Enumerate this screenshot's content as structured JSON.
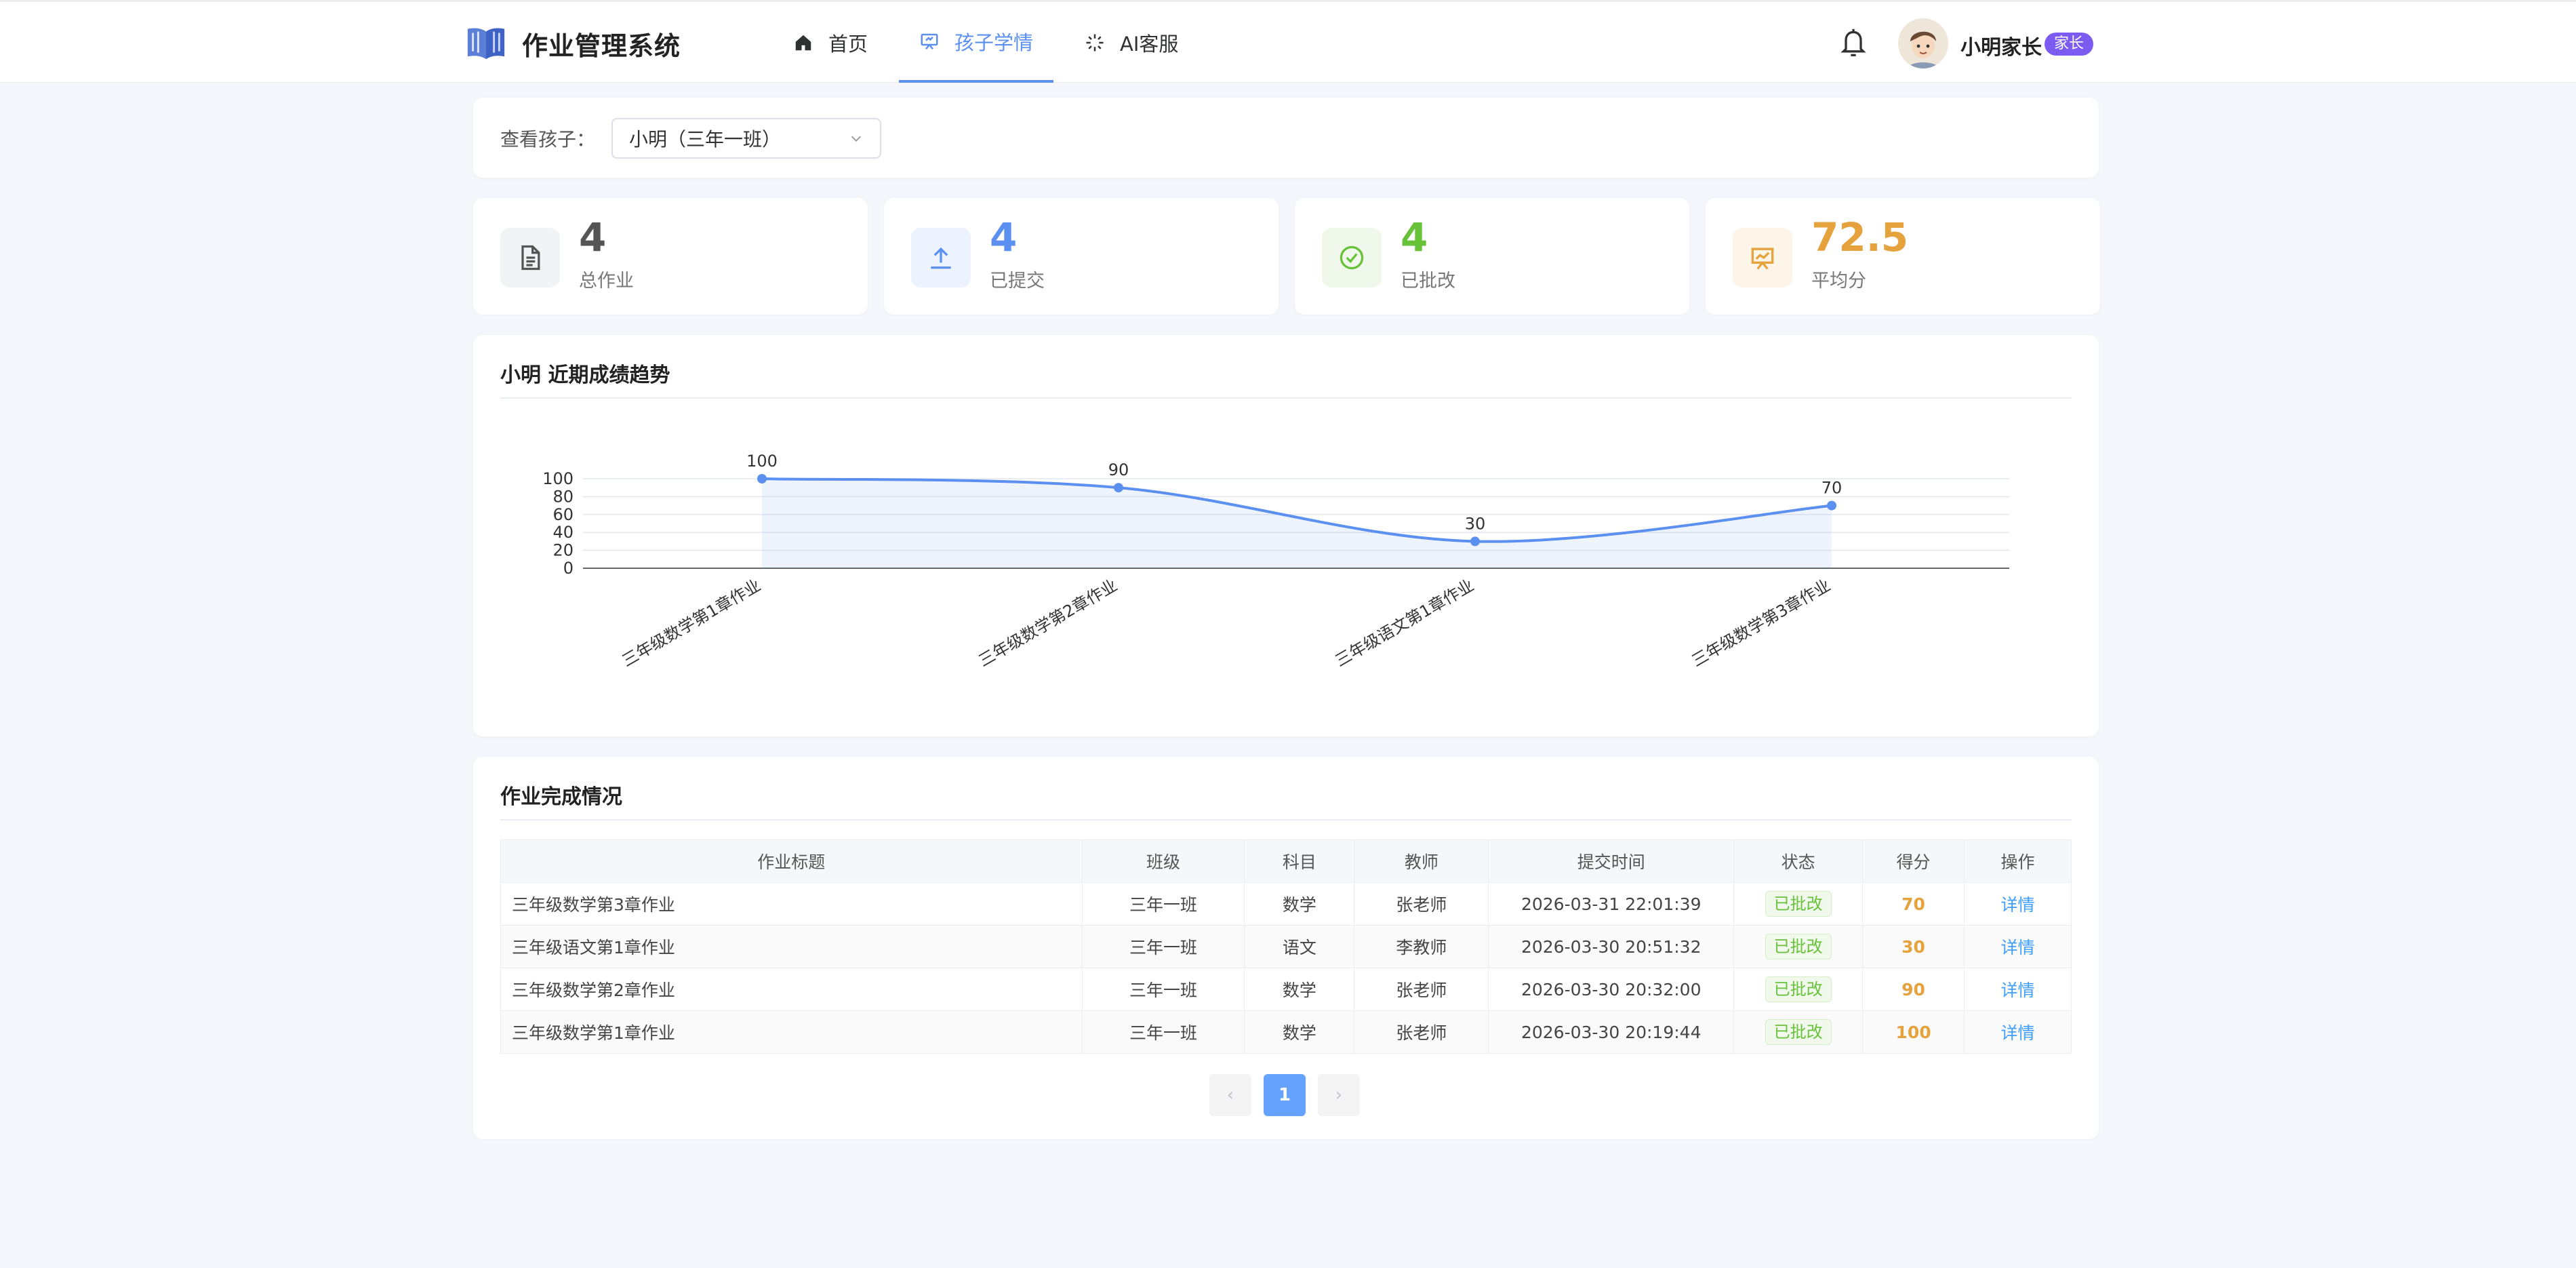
{
  "app": {
    "title": "作业管理系统"
  },
  "nav": [
    {
      "label": "首页",
      "icon": "home-icon",
      "active": false
    },
    {
      "label": "孩子学情",
      "icon": "presentation-icon",
      "active": true
    },
    {
      "label": "AI客服",
      "icon": "sparkle-icon",
      "active": false
    }
  ],
  "user": {
    "name": "小明家长",
    "role": "家长"
  },
  "filter": {
    "label": "查看孩子：",
    "selected": "小明（三年一班）"
  },
  "stats": [
    {
      "value": "4",
      "label": "总作业",
      "icon": "document-icon",
      "color": "#555555"
    },
    {
      "value": "4",
      "label": "已提交",
      "icon": "upload-icon",
      "color": "#5b8ff0"
    },
    {
      "value": "4",
      "label": "已批改",
      "icon": "check-circle-icon",
      "color": "#67c23a"
    },
    {
      "value": "72.5",
      "label": "平均分",
      "icon": "chart-board-icon",
      "color": "#e6a23c"
    }
  ],
  "chart": {
    "title": "小明 近期成绩趋势"
  },
  "chart_data": {
    "type": "area",
    "categories": [
      "三年级数学第1章作业",
      "三年级数学第2章作业",
      "三年级语文第1章作业",
      "三年级数学第3章作业"
    ],
    "values": [
      100,
      90,
      30,
      70
    ],
    "yticks": [
      0,
      20,
      40,
      60,
      80,
      100
    ],
    "ylim": [
      0,
      100
    ],
    "color": "#5b8ff0",
    "grid": true
  },
  "table": {
    "title": "作业完成情况",
    "columns": [
      "作业标题",
      "班级",
      "科目",
      "教师",
      "提交时间",
      "状态",
      "得分",
      "操作"
    ],
    "rows": [
      {
        "title": "三年级数学第3章作业",
        "class": "三年一班",
        "subject": "数学",
        "teacher": "张老师",
        "time": "2026-03-31 22:01:39",
        "status": "已批改",
        "score": "70",
        "action": "详情"
      },
      {
        "title": "三年级语文第1章作业",
        "class": "三年一班",
        "subject": "语文",
        "teacher": "李教师",
        "time": "2026-03-30 20:51:32",
        "status": "已批改",
        "score": "30",
        "action": "详情"
      },
      {
        "title": "三年级数学第2章作业",
        "class": "三年一班",
        "subject": "数学",
        "teacher": "张老师",
        "time": "2026-03-30 20:32:00",
        "status": "已批改",
        "score": "90",
        "action": "详情"
      },
      {
        "title": "三年级数学第1章作业",
        "class": "三年一班",
        "subject": "数学",
        "teacher": "张老师",
        "time": "2026-03-30 20:19:44",
        "status": "已批改",
        "score": "100",
        "action": "详情"
      }
    ]
  },
  "pagination": {
    "prev": "‹",
    "current": "1",
    "next": "›"
  }
}
